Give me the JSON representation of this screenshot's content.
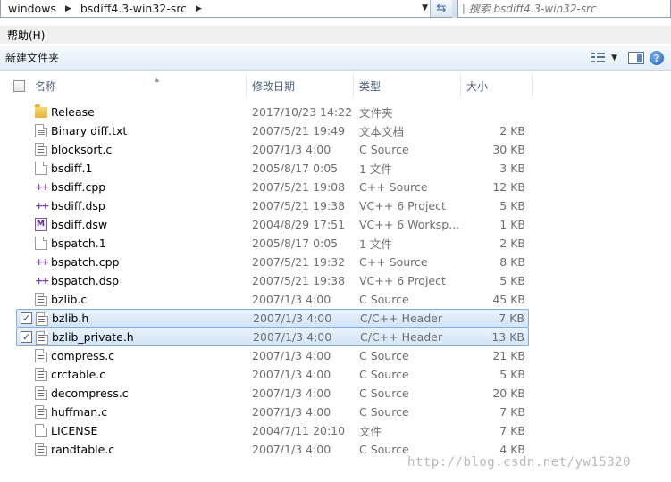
{
  "address": {
    "crumbs": [
      "windows",
      "bsdiff4.3-win32-src"
    ],
    "search_placeholder": "搜索 bsdiff4.3-win32-src"
  },
  "menu": {
    "help": "帮助(H)"
  },
  "toolbar": {
    "new_folder": "新建文件夹"
  },
  "columns": {
    "name": "名称",
    "date": "修改日期",
    "type": "类型",
    "size": "大小"
  },
  "rows": [
    {
      "name": "Release",
      "date": "2017/10/23 14:22",
      "type": "文件夹",
      "size": "",
      "icon": "folder-icon",
      "selected": false
    },
    {
      "name": "Binary diff.txt",
      "date": "2007/5/21 19:49",
      "type": "文本文档",
      "size": "2 KB",
      "icon": "text-file-icon",
      "selected": false
    },
    {
      "name": "blocksort.c",
      "date": "2007/1/3 4:00",
      "type": "C Source",
      "size": "30 KB",
      "icon": "c-file-icon",
      "selected": false
    },
    {
      "name": "bsdiff.1",
      "date": "2005/8/17 0:05",
      "type": "1 文件",
      "size": "3 KB",
      "icon": "blank-file-icon",
      "selected": false
    },
    {
      "name": "bsdiff.cpp",
      "date": "2007/5/21 19:08",
      "type": "C++ Source",
      "size": "12 KB",
      "icon": "cpp-file-icon",
      "selected": false
    },
    {
      "name": "bsdiff.dsp",
      "date": "2007/5/21 19:38",
      "type": "VC++ 6 Project",
      "size": "5 KB",
      "icon": "cpp-file-icon",
      "selected": false
    },
    {
      "name": "bsdiff.dsw",
      "date": "2004/8/29 17:51",
      "type": "VC++ 6 Worksp...",
      "size": "1 KB",
      "icon": "dsw-file-icon",
      "selected": false
    },
    {
      "name": "bspatch.1",
      "date": "2005/8/17 0:05",
      "type": "1 文件",
      "size": "2 KB",
      "icon": "blank-file-icon",
      "selected": false
    },
    {
      "name": "bspatch.cpp",
      "date": "2007/5/21 19:32",
      "type": "C++ Source",
      "size": "8 KB",
      "icon": "cpp-file-icon",
      "selected": false
    },
    {
      "name": "bspatch.dsp",
      "date": "2007/5/21 19:38",
      "type": "VC++ 6 Project",
      "size": "5 KB",
      "icon": "cpp-file-icon",
      "selected": false
    },
    {
      "name": "bzlib.c",
      "date": "2007/1/3 4:00",
      "type": "C Source",
      "size": "45 KB",
      "icon": "c-file-icon",
      "selected": false
    },
    {
      "name": "bzlib.h",
      "date": "2007/1/3 4:00",
      "type": "C/C++ Header",
      "size": "7 KB",
      "icon": "c-file-icon",
      "selected": true
    },
    {
      "name": "bzlib_private.h",
      "date": "2007/1/3 4:00",
      "type": "C/C++ Header",
      "size": "13 KB",
      "icon": "c-file-icon",
      "selected": true
    },
    {
      "name": "compress.c",
      "date": "2007/1/3 4:00",
      "type": "C Source",
      "size": "21 KB",
      "icon": "c-file-icon",
      "selected": false
    },
    {
      "name": "crctable.c",
      "date": "2007/1/3 4:00",
      "type": "C Source",
      "size": "5 KB",
      "icon": "c-file-icon",
      "selected": false
    },
    {
      "name": "decompress.c",
      "date": "2007/1/3 4:00",
      "type": "C Source",
      "size": "20 KB",
      "icon": "c-file-icon",
      "selected": false
    },
    {
      "name": "huffman.c",
      "date": "2007/1/3 4:00",
      "type": "C Source",
      "size": "7 KB",
      "icon": "c-file-icon",
      "selected": false
    },
    {
      "name": "LICENSE",
      "date": "2004/7/11 20:10",
      "type": "文件",
      "size": "7 KB",
      "icon": "blank-file-icon",
      "selected": false
    },
    {
      "name": "randtable.c",
      "date": "2007/1/3 4:00",
      "type": "C Source",
      "size": "4 KB",
      "icon": "c-file-icon",
      "selected": false
    }
  ],
  "watermark": "http://blog.csdn.net/yw15320"
}
